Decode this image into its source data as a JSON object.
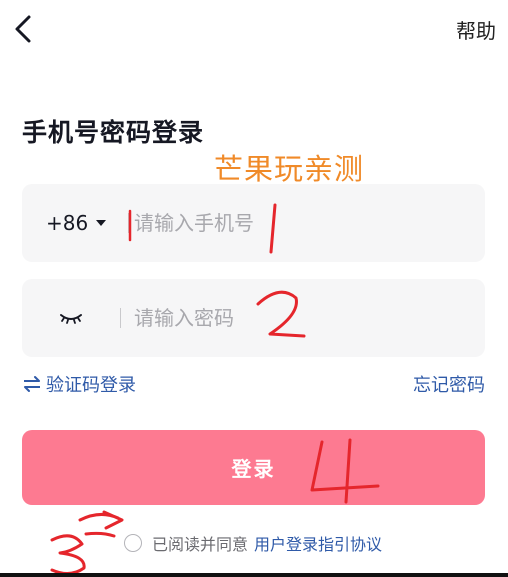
{
  "header": {
    "help_label": "帮助"
  },
  "page": {
    "title": "手机号密码登录",
    "watermark": "芒果玩亲测"
  },
  "phone_field": {
    "country_code": "+86",
    "placeholder": "请输入手机号",
    "value": ""
  },
  "password_field": {
    "placeholder": "请输入密码",
    "value": ""
  },
  "links": {
    "sms_login": "验证码登录",
    "forgot_password": "忘记密码"
  },
  "login_button": {
    "label": "登录"
  },
  "agreement": {
    "prefix": "已阅读并同意",
    "link": "用户登录指引协议"
  },
  "annotations": {
    "color": "#e5262c",
    "marks": [
      "1",
      "2",
      "3",
      "4"
    ]
  },
  "colors": {
    "primary_button": "#fd7a91",
    "link": "#2f5aa8",
    "watermark": "#f08a28"
  }
}
